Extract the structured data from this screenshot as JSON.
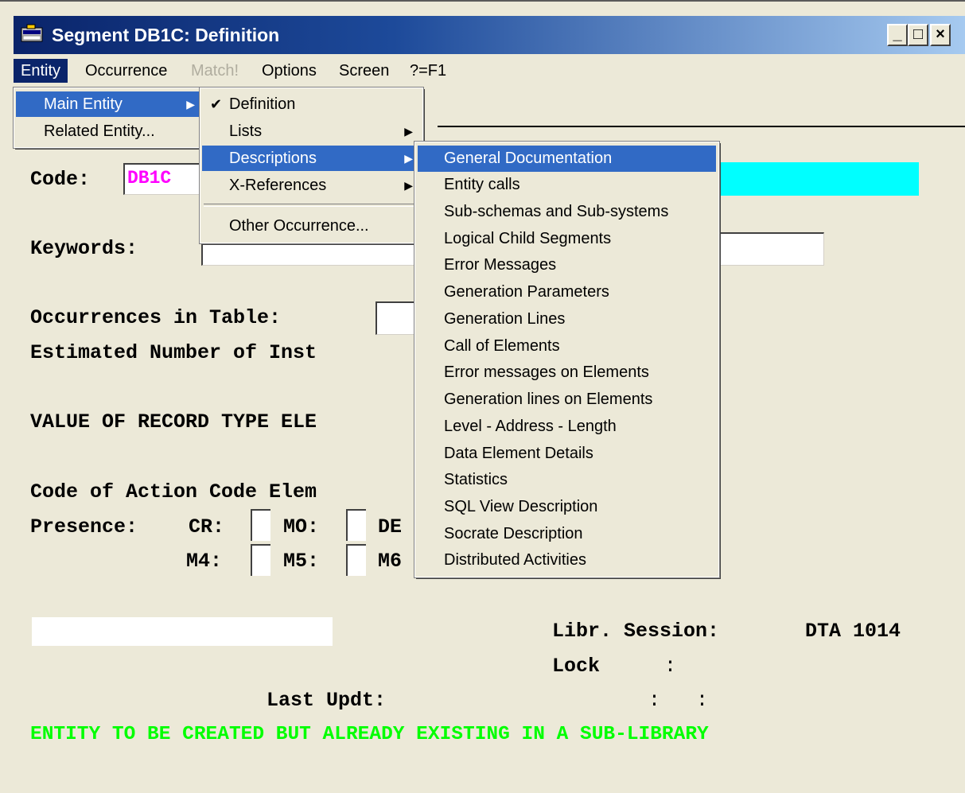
{
  "window": {
    "title": "Segment DB1C: Definition",
    "buttons": {
      "minimize": "_",
      "maximize": "□",
      "close": "×"
    }
  },
  "menubar": {
    "items": [
      {
        "label": "Entity",
        "state": "active"
      },
      {
        "label": "Occurrence",
        "state": "normal"
      },
      {
        "label": "Match!",
        "state": "disabled"
      },
      {
        "label": "Options",
        "state": "normal"
      },
      {
        "label": "Screen",
        "state": "normal"
      },
      {
        "label": "?=F1",
        "state": "normal"
      }
    ]
  },
  "entity_menu": {
    "items": [
      {
        "label": "Main Entity",
        "has_submenu": true,
        "highlighted": true
      },
      {
        "label": "Related Entity...",
        "has_submenu": false,
        "highlighted": false
      }
    ]
  },
  "main_entity_menu": {
    "items": [
      {
        "label": "Definition",
        "checked": true,
        "has_submenu": false
      },
      {
        "label": "Lists",
        "checked": false,
        "has_submenu": true
      },
      {
        "label": "Descriptions",
        "checked": false,
        "has_submenu": true,
        "highlighted": true
      },
      {
        "label": "X-References",
        "checked": false,
        "has_submenu": true
      },
      {
        "label": "Other Occurrence...",
        "checked": false,
        "has_submenu": false
      }
    ]
  },
  "descriptions_menu": {
    "items": [
      "General Documentation",
      "Entity calls",
      "Sub-schemas and Sub-systems",
      "Logical Child Segments",
      "Error Messages",
      "Generation Parameters",
      "Generation Lines",
      "Call of Elements",
      "Error messages on Elements",
      "Generation lines on Elements",
      "Level - Address - Length",
      "Data Element Details",
      "Statistics",
      "SQL View Description",
      "Socrate Description",
      "Distributed Activities"
    ],
    "highlighted_index": 0
  },
  "form": {
    "code_label": "Code:",
    "code_value": "DB1C",
    "keywords_label": "Keywords:",
    "occurrences_label": "Occurrences in Table:",
    "estimated_label": "Estimated Number of Inst",
    "value_record_label": "VALUE OF RECORD TYPE ELE",
    "action_code_label": "Code of Action Code Elem",
    "presence_label": "Presence:",
    "cr_label": "CR:",
    "mo_label": "MO:",
    "de_label": "DE",
    "m4_label": "M4:",
    "m5_label": "M5:",
    "m6_label": "M6",
    "libr_session_label": "Libr. Session:",
    "libr_session_value": "DTA 1014",
    "lock_label": "Lock",
    "lock_colon": ":",
    "last_updt_label": "Last Updt:",
    "last_updt_value": ":   :",
    "status_message": "ENTITY TO BE CREATED BUT ALREADY EXISTING IN A SUB-LIBRARY"
  },
  "colors": {
    "code_value": "#ff00ff",
    "cyan_field": "#00ffff",
    "status_message": "#00ff00",
    "menu_highlight": "#316ac5"
  }
}
